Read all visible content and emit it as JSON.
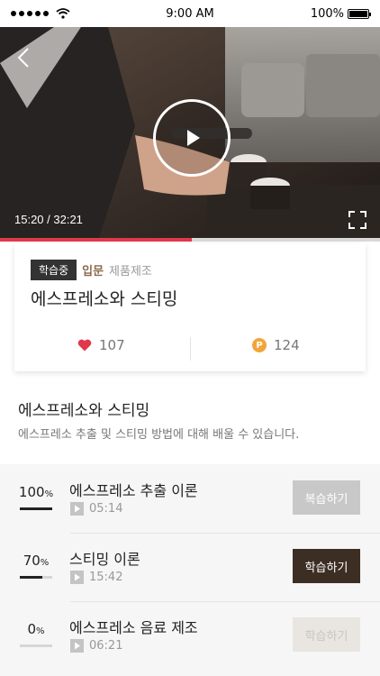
{
  "status_bar": {
    "time": "9:00 AM",
    "battery": "100%"
  },
  "video": {
    "time": "15:20 / 32:21",
    "progress": 0.504
  },
  "course": {
    "badge": "학습중",
    "level": "입문",
    "category": "제품제조",
    "title": "에스프레소와 스티밍",
    "likes": "107",
    "points": "124",
    "point_symbol": "P"
  },
  "description": {
    "title": "에스프레소와 스티밍",
    "text": "에스프레소 추출 및 스티밍 방법에 대해 배울 수 있습니다."
  },
  "lessons": [
    {
      "percent": "100",
      "percent_unit": "%",
      "progress": 1.0,
      "title": "에스프레소 추출 이론",
      "duration": "05:14",
      "action": "복습하기",
      "state": "review"
    },
    {
      "percent": "70",
      "percent_unit": "%",
      "progress": 0.7,
      "title": "스티밍 이론",
      "duration": "15:42",
      "action": "학습하기",
      "state": "study"
    },
    {
      "percent": "0",
      "percent_unit": "%",
      "progress": 0.0,
      "title": "에스프레소 음료 제조",
      "duration": "06:21",
      "action": "학습하기",
      "state": "disabled"
    }
  ],
  "icons": {
    "back": "back-arrow-icon",
    "play": "play-icon",
    "fullscreen": "fullscreen-icon",
    "like": "heart-icon",
    "point": "point-coin-icon",
    "video_small": "video-play-icon"
  },
  "colors": {
    "accent": "#e0394a",
    "dark_button": "#3d2e24",
    "level_text": "#8a6a4a",
    "coin": "#f2a53a"
  }
}
